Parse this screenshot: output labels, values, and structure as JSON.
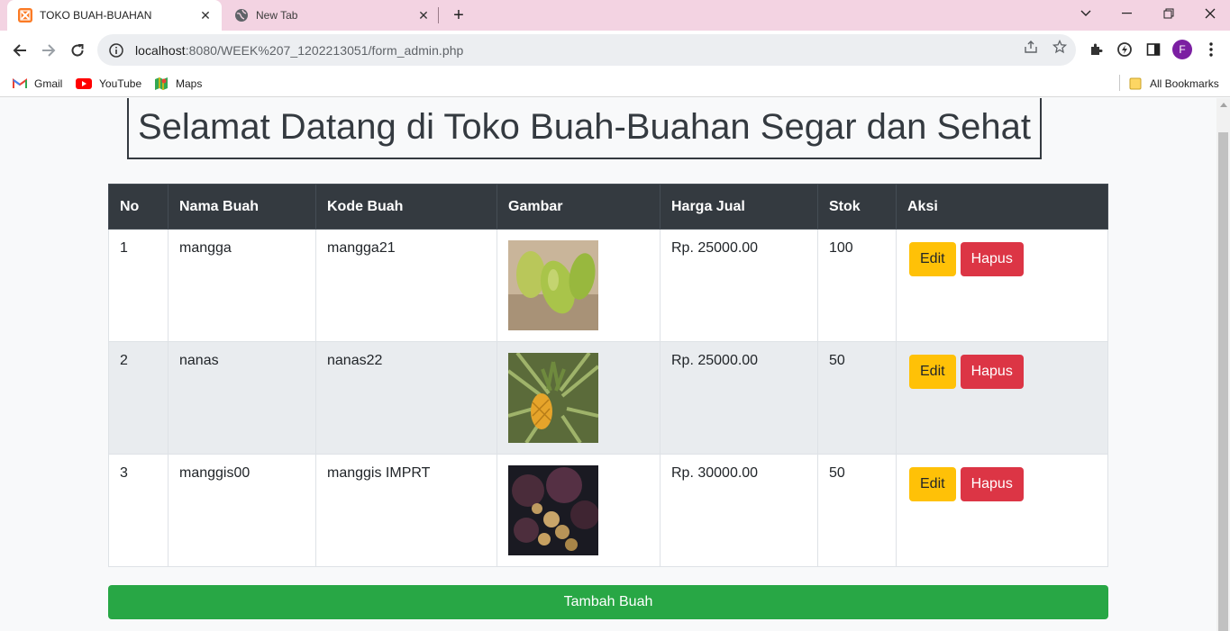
{
  "browser": {
    "tabs": [
      {
        "title": "TOKO BUAH-BUAHAN",
        "active": true
      },
      {
        "title": "New Tab",
        "active": false
      }
    ],
    "url_host": "localhost",
    "url_rest": ":8080/WEEK%207_1202213051/form_admin.php",
    "profile_initial": "F",
    "bookmarks": [
      {
        "label": "Gmail",
        "icon": "gmail-icon"
      },
      {
        "label": "YouTube",
        "icon": "youtube-icon"
      },
      {
        "label": "Maps",
        "icon": "maps-icon"
      }
    ],
    "all_bookmarks": "All Bookmarks"
  },
  "page": {
    "title": "Selamat Datang di Toko Buah-Buahan Segar dan Sehat",
    "table": {
      "headers": [
        "No",
        "Nama Buah",
        "Kode Buah",
        "Gambar",
        "Harga Jual",
        "Stok",
        "Aksi"
      ],
      "rows": [
        {
          "no": "1",
          "nama": "mangga",
          "kode": "mangga21",
          "gambar": "mango",
          "harga": "Rp. 25000.00",
          "stok": "100"
        },
        {
          "no": "2",
          "nama": "nanas",
          "kode": "nanas22",
          "gambar": "pineapple",
          "harga": "Rp. 25000.00",
          "stok": "50"
        },
        {
          "no": "3",
          "nama": "manggis00",
          "kode": "manggis IMPRT",
          "gambar": "mangosteen",
          "harga": "Rp. 30000.00",
          "stok": "50"
        }
      ]
    },
    "edit_label": "Edit",
    "hapus_label": "Hapus",
    "add_label": "Tambah Buah"
  },
  "colors": {
    "header_bg": "#343a40",
    "edit": "#ffc107",
    "hapus": "#dc3545",
    "add": "#28a745"
  }
}
